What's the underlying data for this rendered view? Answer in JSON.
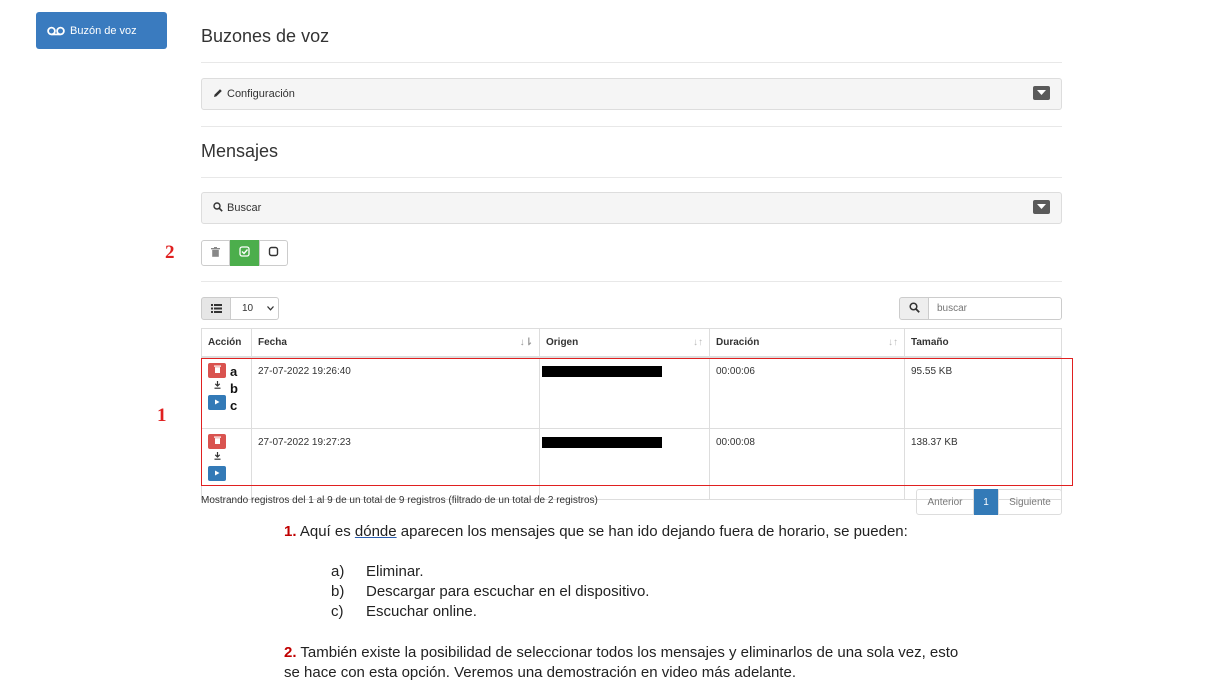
{
  "sidebar": {
    "voicemail_button": "Buzón de voz"
  },
  "header": {
    "title": "Buzones de voz"
  },
  "config_panel": {
    "label": "Configuración"
  },
  "messages_section": {
    "title": "Mensajes"
  },
  "search_panel": {
    "label": "Buscar"
  },
  "annotations": {
    "n1": "1",
    "n2": "2",
    "la": "a",
    "lb": "b",
    "lc": "c"
  },
  "table_controls": {
    "page_size": "10",
    "search_placeholder": "buscar"
  },
  "table": {
    "headers": [
      "Acción",
      "Fecha",
      "Origen",
      "Duración",
      "Tamaño"
    ],
    "rows": [
      {
        "fecha": "27-07-2022 19:26:40",
        "duracion": "00:00:06",
        "tamano": "95.55 KB"
      },
      {
        "fecha": "27-07-2022 19:27:23",
        "duracion": "00:00:08",
        "tamano": "138.37 KB"
      }
    ]
  },
  "footer": {
    "info": "Mostrando registros del 1 al 9 de un total de 9 registros (filtrado de un total de 2 registros)",
    "prev": "Anterior",
    "page": "1",
    "next": "Siguiente"
  },
  "notes": {
    "p1_num": "1.",
    "p1_a": " Aquí es ",
    "p1_u": "dónde",
    "p1_b": " aparecen los mensajes que se han ido dejando fuera de horario, se pueden:",
    "items": [
      {
        "letter": "a)",
        "text": "Eliminar."
      },
      {
        "letter": "b)",
        "text": "Descargar para escuchar en el dispositivo."
      },
      {
        "letter": "c)",
        "text": "Escuchar online."
      }
    ],
    "p2_num": "2.",
    "p2_line1": " También existe la posibilidad de seleccionar todos los mensajes y eliminarlos de una sola vez, esto",
    "p2_line2": "se hace con esta opción. Veremos una demostración en video más adelante."
  },
  "colors": {
    "primary": "#337ab7",
    "danger": "#d9534f",
    "success": "#4cae4c",
    "annotation_red": "#e02020"
  }
}
